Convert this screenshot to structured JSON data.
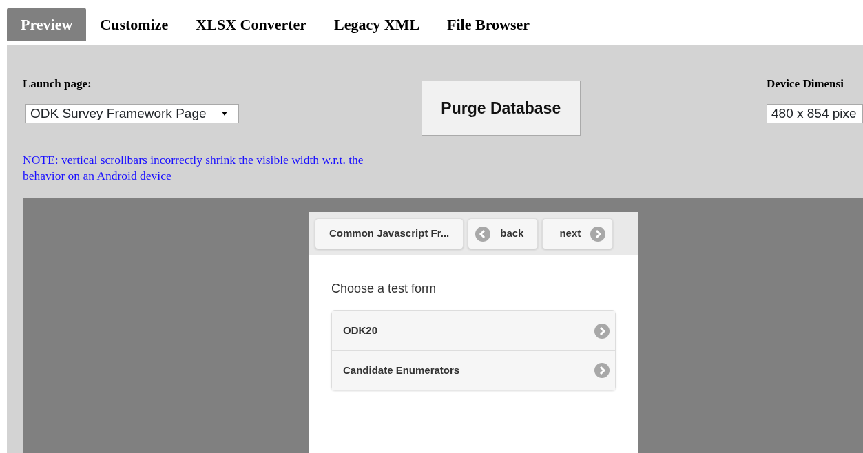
{
  "tabs": [
    {
      "label": "Preview",
      "selected": true
    },
    {
      "label": "Customize",
      "selected": false
    },
    {
      "label": "XLSX Converter",
      "selected": false
    },
    {
      "label": "Legacy XML",
      "selected": false
    },
    {
      "label": "File Browser",
      "selected": false
    }
  ],
  "launch": {
    "label": "Launch page:",
    "value": "ODK Survey Framework Page"
  },
  "purge_button": "Purge Database",
  "device": {
    "label": "Device Dimensi",
    "value": "480 x 854 pixe"
  },
  "note": "NOTE: vertical scrollbars incorrectly shrink the visible width w.r.t. the behavior on an Android device",
  "preview": {
    "header_buttons": [
      {
        "label": "Common Javascript Fr...",
        "kind": "title"
      },
      {
        "label": "back",
        "kind": "back"
      },
      {
        "label": "next",
        "kind": "next"
      }
    ],
    "prompt": "Choose a test form",
    "forms": [
      {
        "label": "ODK20"
      },
      {
        "label": "Candidate Enumerators"
      }
    ]
  }
}
